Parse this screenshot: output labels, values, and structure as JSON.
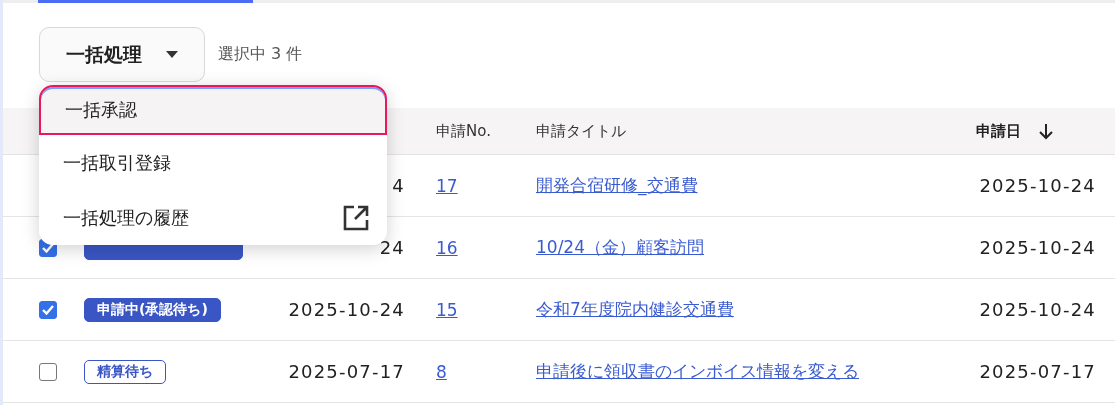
{
  "toolbar": {
    "bulk_button": "一括処理",
    "selection_count": "選択中 3 件"
  },
  "menu": {
    "items": [
      {
        "label": "一括承認",
        "selected": true,
        "external": false
      },
      {
        "label": "一括取引登録",
        "selected": false,
        "external": false
      },
      {
        "label": "一括処理の履歴",
        "selected": false,
        "external": true
      }
    ]
  },
  "table": {
    "columns": [
      {
        "label": "申請No.",
        "sorted": false
      },
      {
        "label": "申請タイトル",
        "sorted": false
      },
      {
        "label": "申請日",
        "sorted": true
      }
    ],
    "rows": [
      {
        "date": "4",
        "number": "17",
        "title": "開発合宿研修_交通費",
        "application_date": "2025-10-24"
      },
      {
        "checked": true,
        "status": {
          "kind": "filled"
        },
        "date": "24",
        "number": "16",
        "title": "10/24（金）顧客訪問",
        "application_date": "2025-10-24"
      },
      {
        "checked": true,
        "status": {
          "label": "申請中(承認待ち)",
          "kind": "filled"
        },
        "date": "2025-10-24",
        "number": "15",
        "title": "令和7年度院内健診交通費",
        "application_date": "2025-10-24"
      },
      {
        "checked": false,
        "status": {
          "label": "精算待ち",
          "kind": "outline"
        },
        "date": "2025-07-17",
        "number": "8",
        "title": "申請後に領収書のインボイス情報を変える",
        "application_date": "2025-07-17"
      }
    ]
  }
}
